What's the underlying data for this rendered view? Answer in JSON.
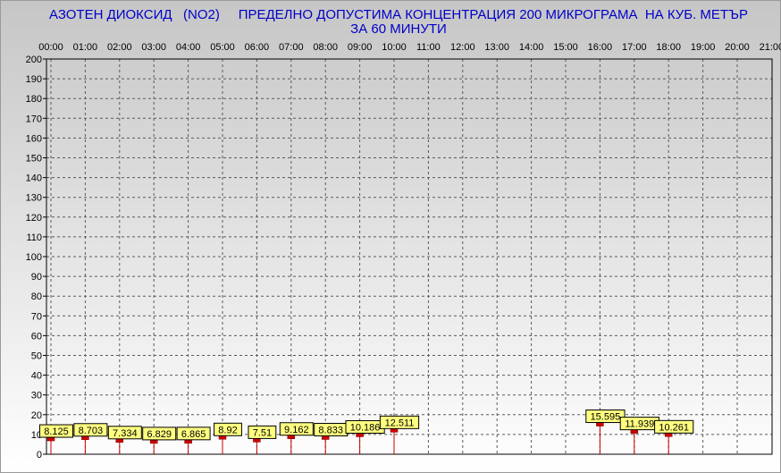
{
  "chart_data": {
    "type": "bar",
    "title_line1": "АЗОТЕН ДИОКСИД   (NO2)     ПРЕДЕЛНО ДОПУСТИМА КОНЦЕНТРАЦИЯ 200 МИКРОГРАМА  НА КУБ. МЕТЪР",
    "title_line2": "ЗА 60 МИНУТИ",
    "categories": [
      "00:00",
      "01:00",
      "02:00",
      "03:00",
      "04:00",
      "05:00",
      "06:00",
      "07:00",
      "08:00",
      "09:00",
      "10:00",
      "11:00",
      "12:00",
      "13:00",
      "14:00",
      "15:00",
      "16:00",
      "17:00",
      "18:00",
      "19:00",
      "20:00",
      "21:00"
    ],
    "values": [
      8.125,
      8.703,
      7.334,
      6.829,
      6.865,
      8.92,
      7.51,
      9.162,
      8.833,
      10.186,
      12.511,
      null,
      null,
      null,
      null,
      null,
      15.595,
      11.939,
      10.261,
      null,
      null
    ],
    "labels": [
      "8.125",
      "8.703",
      "7.334",
      "6.829",
      "6.865",
      "8.92",
      "7.51",
      "9.162",
      "8.833",
      "10.186",
      "12.511",
      "",
      "",
      "",
      "",
      "",
      "15.595",
      "11.939",
      "10.261",
      "",
      ""
    ],
    "ylim": [
      0,
      200
    ],
    "yticks": [
      "0",
      "10",
      "20",
      "30",
      "40",
      "50",
      "60",
      "70",
      "80",
      "90",
      "100",
      "110",
      "120",
      "130",
      "140",
      "150",
      "160",
      "170",
      "180",
      "190",
      "200"
    ],
    "grid": true,
    "colors": {
      "title": "#0000c8",
      "axis_text": "#000000",
      "background_top": "#c8c8c8",
      "background_bottom": "#ffffff",
      "marker": "#cc0000",
      "label_fill": "#ffff80",
      "grid": "#606060"
    }
  }
}
